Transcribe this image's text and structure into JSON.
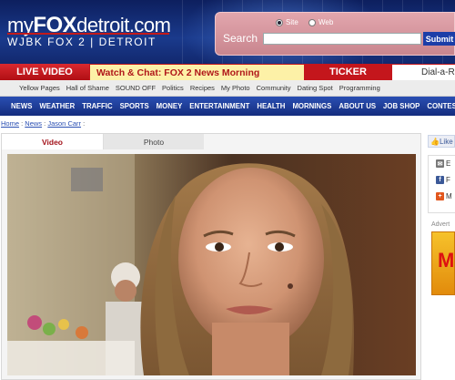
{
  "header": {
    "logo_my": "my",
    "logo_fox": "FOX",
    "logo_city": "detroit.com",
    "logo_sub": "WJBK FOX 2 | DETROIT",
    "search": {
      "radio_site": "Site",
      "radio_web": "Web",
      "selected": "Site",
      "label": "Search",
      "input_value": "",
      "submit_label": "Submit"
    }
  },
  "redbar": {
    "live_video": "LIVE VIDEO",
    "watch_chat": "Watch & Chat: FOX 2 News Morning",
    "ticker": "TICKER",
    "dial": "Dial-a-R"
  },
  "sublinks": [
    "Yellow Pages",
    "Hall of Shame",
    "SOUND OFF",
    "Politics",
    "Recipes",
    "My Photo",
    "Community",
    "Dating Spot",
    "Programming"
  ],
  "mainnav": [
    "NEWS",
    "WEATHER",
    "TRAFFIC",
    "SPORTS",
    "MONEY",
    "ENTERTAINMENT",
    "HEALTH",
    "MORNINGS",
    "ABOUT US",
    "JOB SHOP",
    "CONTESTS"
  ],
  "breadcrumb": {
    "items": [
      "Home",
      "News",
      "Jason Carr"
    ],
    "separator": ":"
  },
  "media": {
    "tabs": [
      "Video",
      "Photo"
    ],
    "active_tab": "Video"
  },
  "right": {
    "like_label": "Like",
    "share_items": [
      {
        "icon": "email-icon",
        "label": "E"
      },
      {
        "icon": "facebook-icon",
        "label": "F"
      },
      {
        "icon": "more-share-icon",
        "label": "M"
      }
    ],
    "advert_label": "Advert",
    "ad_text": "M"
  },
  "colors": {
    "brand_blue": "#1a3a8c",
    "brand_red": "#c4161c",
    "chat_yellow": "#fdf1a7",
    "nav_blue": "#2a4fb3"
  }
}
